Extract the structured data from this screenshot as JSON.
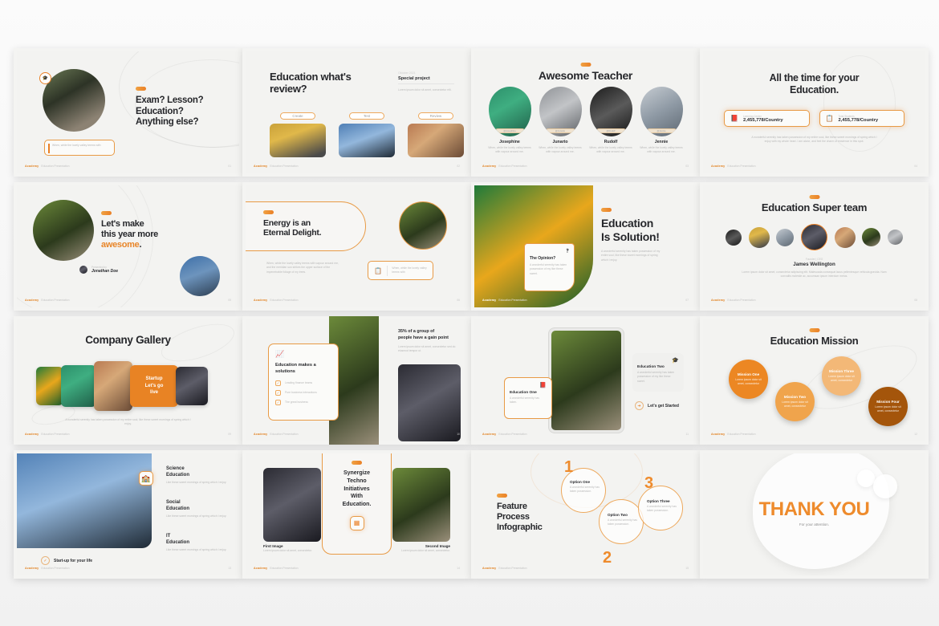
{
  "meta": {
    "accent": "#ea8026",
    "accent_light": "#f0a243",
    "accent_dark": "#b35f15",
    "page_bg": "#f2f2f2",
    "slide_bg": "#f3f3f1",
    "text_dark": "#26272b"
  },
  "footer": {
    "brand": "Academy",
    "tagline": "Education Presentation",
    "page_prefix": "Page"
  },
  "slides": [
    {
      "id": "slide-01-title",
      "name": "exam-lesson-education",
      "page": "01",
      "title_lines": [
        "Exam? Lesson?",
        "Education?",
        "Anything else?"
      ],
      "quote": "When, while the lovely valley teems with",
      "icon": "graduation-cap-icon"
    },
    {
      "id": "slide-02-review",
      "name": "education-whats-review",
      "page": "02",
      "title_lines": [
        "Education what's",
        "review?"
      ],
      "eyebrow": "Oktober 2021",
      "subtitle": "Special project",
      "body": "Lorem ipsum dolor sit amet, consectetur elit.",
      "tags": [
        "Create",
        "Test",
        "Review"
      ]
    },
    {
      "id": "slide-03-teacher",
      "name": "awesome-teacher",
      "page": "03",
      "title": "Awesome Teacher",
      "people": [
        {
          "name": "Josephine",
          "handle": "@Josephine",
          "desc": "When, while the lovely valley teems with vapour around me."
        },
        {
          "name": "Junarto",
          "handle": "@Junarto",
          "desc": "When, while the lovely valley teems with vapour around me."
        },
        {
          "name": "Rudolf",
          "handle": "@Rudolf",
          "desc": "When, while the lovely valley teems with vapour around me."
        },
        {
          "name": "Jennie",
          "handle": "@Jennie",
          "desc": "When, while the lovely valley teems with vapour around me."
        }
      ]
    },
    {
      "id": "slide-04-stats",
      "name": "all-the-time-for-your-education",
      "page": "04",
      "title_lines": [
        "All the time for your",
        "Education."
      ],
      "stats": [
        {
          "label": "Learning Center",
          "value": "2,455,778/Country",
          "icon": "book-icon"
        },
        {
          "label": "Total Students",
          "value": "2,455,778/Country",
          "icon": "list-icon"
        }
      ],
      "body": "A wonderful serenity has taken possession of my entire soul, like these sweet mornings of spring which I enjoy with my whole heart. I am alone, and feel the charm of existence in this spot."
    },
    {
      "id": "slide-05-awesome",
      "name": "lets-make-this-year-more-awesome",
      "page": "05",
      "title_lines": [
        "Let's make",
        "this year more"
      ],
      "title_accent": "awesome",
      "credit_label": "Presented by",
      "credit_name": "Jonathan Doe"
    },
    {
      "id": "slide-06-energy",
      "name": "energy-is-an-eternal-delight",
      "page": "06",
      "title_lines": [
        "Energy is an",
        "Eternal Delight."
      ],
      "body": "When, while the lovely valley teems with vapour around me, and the meridian sun strikes the upper surface of the impenetrable foliage of my trees.",
      "note": "When, while the lovely valley teems with",
      "note_icon": "list-icon"
    },
    {
      "id": "slide-07-solution",
      "name": "education-is-solution",
      "page": "07",
      "title_accent": "Education",
      "title_dark": "Is Solution!",
      "body": "A wonderful serenity has taken possession of my entire soul, like these sweet mornings of spring which I enjoy.",
      "card_title": "The Opinion?",
      "card_body": "A wonderful serenity has taken possession of my like these sweet.",
      "card_icon": "quote-icon"
    },
    {
      "id": "slide-08-team",
      "name": "education-super-team",
      "page": "08",
      "title": "Education Super team",
      "role": "Founder | CEO",
      "person": "James Wellington",
      "body": "Lorem ipsum dolor sit amet, consectetur adipiscing elit. Malesuada consequat lacus pellentesque vehicula gravida. Nam convallis molestie ac, accumsan ipsum interdum metus."
    },
    {
      "id": "slide-09-gallery",
      "name": "company-gallery",
      "page": "09",
      "title": "Company Gallery",
      "cta_lines": [
        "Startup",
        "Let's go",
        "live"
      ],
      "body": "A wonderful serenity has taken possession of my entire soul, like these sweet mornings of spring which I enjoy."
    },
    {
      "id": "slide-10-solutions",
      "name": "education-makes-a-solutions",
      "page": "10",
      "title_lines": [
        "Education makes a",
        "solutions"
      ],
      "checklist": [
        "Leading finance teams",
        "Pure business interactions",
        "The great business"
      ],
      "right_title_lines": [
        "35% of a group of",
        "people have a gain point"
      ],
      "right_body": "Lorem ipsum dolor sit amet, consectetur sed do eiusmod tempor ut.",
      "icon": "chart-icon"
    },
    {
      "id": "slide-11-device",
      "name": "education-one-two",
      "page": "11",
      "cards": [
        {
          "title": "Education One",
          "body": "A wonderful serenity has taken.",
          "icon": "book-icon"
        },
        {
          "title": "Education Two",
          "body": "A wonderful serenity has taken possession of my like these sweet.",
          "icon": "graduation-cap-icon"
        }
      ],
      "cta": "Let's get Started",
      "cta_icon": "arrow-right-icon"
    },
    {
      "id": "slide-12-mission",
      "name": "education-mission",
      "page": "12",
      "title": "Education Mission",
      "missions": [
        {
          "title": "Mission One",
          "body": "Lorem ipsum dolor sit amet, consectetur",
          "color": "#ec8723"
        },
        {
          "title": "Mission Two",
          "body": "Lorem ipsum dolor sit amet, consectetur",
          "color": "#f0a44c"
        },
        {
          "title": "Mission Three",
          "body": "Lorem ipsum dolor sit amet, consectetur",
          "color": "#f3b877"
        },
        {
          "title": "Mission Four",
          "body": "Lorem ipsum dolor sit amet, consectetur",
          "color": "#a4550b"
        }
      ]
    },
    {
      "id": "slide-13-categories",
      "name": "education-categories",
      "page": "13",
      "items": [
        {
          "title_lines": [
            "Science",
            "Education"
          ],
          "body": "Like these sweet mornings of spring which I enjoy."
        },
        {
          "title_lines": [
            "Social",
            "Education"
          ],
          "body": "Like these sweet mornings of spring which I enjoy."
        },
        {
          "title_lines": [
            "IT",
            "Education"
          ],
          "body": "Like these sweet mornings of spring which I enjoy."
        }
      ],
      "cta": "Start-up for your life",
      "cta_icon": "check-circle-icon",
      "badge_icon": "school-icon"
    },
    {
      "id": "slide-14-synergize",
      "name": "synergize-techno-initiatives",
      "page": "14",
      "title_lines": [
        "Synergize",
        "Techno",
        "Initiatives",
        "With",
        "Education."
      ],
      "icon": "grid-icon",
      "left_caption_title": "First Image",
      "left_caption_body": "Lorem ipsum dolor sit amet, consectetur.",
      "right_caption_title": "Second Image",
      "right_caption_body": "Lorem ipsum dolor sit amet, consectetur."
    },
    {
      "id": "slide-15-process",
      "name": "feature-process-infographic",
      "page": "15",
      "title_lines": [
        "Feature",
        "Process",
        "Infographic"
      ],
      "steps": [
        {
          "num": "1",
          "title": "Option One",
          "body": "A wonderful serenity has taken possession."
        },
        {
          "num": "2",
          "title": "Option Two",
          "body": "A wonderful serenity has taken possession."
        },
        {
          "num": "3",
          "title": "Option Three",
          "body": "A wonderful serenity has taken possession."
        }
      ]
    },
    {
      "id": "slide-16-thanks",
      "name": "thank-you",
      "page": "16",
      "title": "THANK YOU",
      "subtitle": "For your attention."
    }
  ]
}
